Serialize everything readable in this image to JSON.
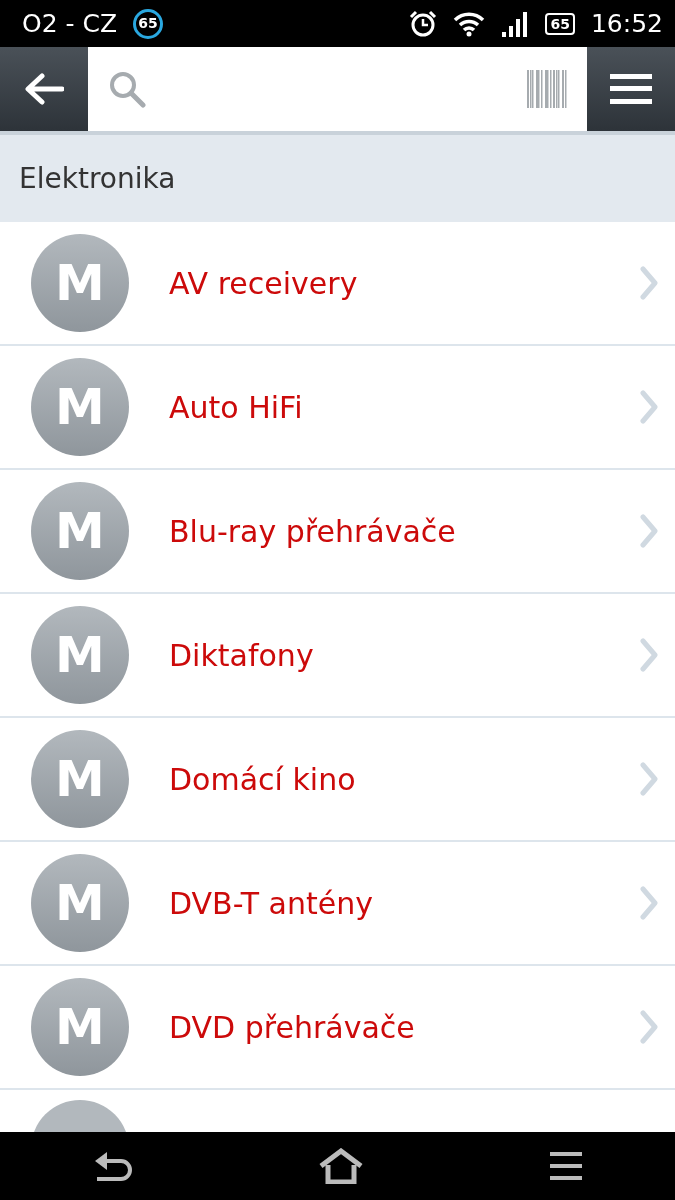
{
  "status_bar": {
    "carrier": "O2 - CZ",
    "notification_badge": "65",
    "battery": "65",
    "time": "16:52"
  },
  "section": {
    "title": "Elektronika"
  },
  "categories": [
    {
      "label": "AV receivery",
      "logo": "M"
    },
    {
      "label": "Auto HiFi",
      "logo": "M"
    },
    {
      "label": "Blu-ray přehrávače",
      "logo": "M"
    },
    {
      "label": "Diktafony",
      "logo": "M"
    },
    {
      "label": "Domácí kino",
      "logo": "M"
    },
    {
      "label": "DVB-T antény",
      "logo": "M"
    },
    {
      "label": "DVD přehrávače",
      "logo": "M"
    }
  ]
}
